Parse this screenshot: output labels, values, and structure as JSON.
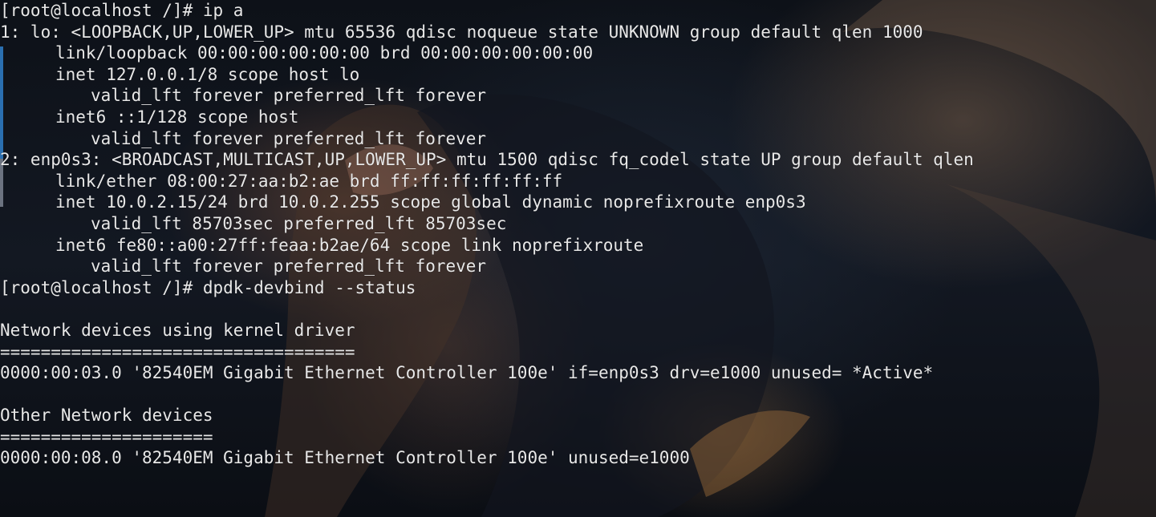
{
  "terminal": {
    "lines": [
      {
        "indent": 0,
        "text": "[root@localhost /]# ip a"
      },
      {
        "indent": 0,
        "text": "1: lo: <LOOPBACK,UP,LOWER_UP> mtu 65536 qdisc noqueue state UNKNOWN group default qlen 1000"
      },
      {
        "indent": 1,
        "text": "link/loopback 00:00:00:00:00:00 brd 00:00:00:00:00:00"
      },
      {
        "indent": 1,
        "text": "inet 127.0.0.1/8 scope host lo"
      },
      {
        "indent": 2,
        "text": "valid_lft forever preferred_lft forever"
      },
      {
        "indent": 1,
        "text": "inet6 ::1/128 scope host"
      },
      {
        "indent": 2,
        "text": "valid_lft forever preferred_lft forever"
      },
      {
        "indent": 0,
        "text": "2: enp0s3: <BROADCAST,MULTICAST,UP,LOWER_UP> mtu 1500 qdisc fq_codel state UP group default qlen"
      },
      {
        "indent": 1,
        "text": "link/ether 08:00:27:aa:b2:ae brd ff:ff:ff:ff:ff:ff"
      },
      {
        "indent": 1,
        "text": "inet 10.0.2.15/24 brd 10.0.2.255 scope global dynamic noprefixroute enp0s3"
      },
      {
        "indent": 2,
        "text": "valid_lft 85703sec preferred_lft 85703sec"
      },
      {
        "indent": 1,
        "text": "inet6 fe80::a00:27ff:feaa:b2ae/64 scope link noprefixroute"
      },
      {
        "indent": 2,
        "text": "valid_lft forever preferred_lft forever"
      },
      {
        "indent": 0,
        "text": "[root@localhost /]# dpdk-devbind --status"
      },
      {
        "indent": 0,
        "text": ""
      },
      {
        "indent": 0,
        "text": "Network devices using kernel driver"
      },
      {
        "indent": 0,
        "text": "==================================="
      },
      {
        "indent": 0,
        "text": "0000:00:03.0 '82540EM Gigabit Ethernet Controller 100e' if=enp0s3 drv=e1000 unused= *Active*"
      },
      {
        "indent": 0,
        "text": ""
      },
      {
        "indent": 0,
        "text": "Other Network devices"
      },
      {
        "indent": 0,
        "text": "====================="
      },
      {
        "indent": 0,
        "text": "0000:00:08.0 '82540EM Gigabit Ethernet Controller 100e' unused=e1000"
      }
    ]
  },
  "colors": {
    "text": "#e8e8e8",
    "background": "#0d1118",
    "edge_accent": "#2a6fb0"
  }
}
